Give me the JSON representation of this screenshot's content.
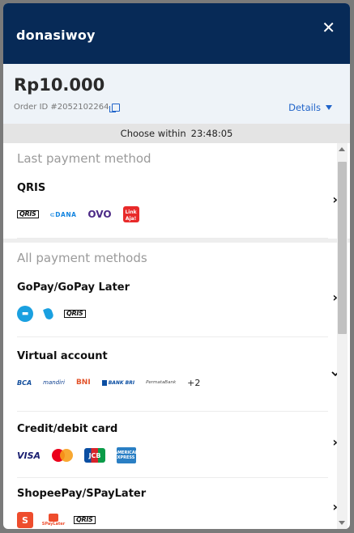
{
  "header": {
    "merchant_name": "donasiwoy",
    "close_icon": "close-icon"
  },
  "summary": {
    "amount": "Rp10.000",
    "order_id": "Order ID #2052102264",
    "details_label": "Details"
  },
  "timer": {
    "label": "Choose within",
    "time": "23:48:05"
  },
  "last_payment": {
    "title": "Last payment method",
    "method": {
      "name": "QRIS",
      "logos": [
        "QRIS",
        "DANA",
        "OVO",
        "LinkAja"
      ]
    }
  },
  "all_payment": {
    "title": "All payment methods",
    "methods": [
      {
        "name": "GoPay/GoPay Later",
        "logos": [
          "gopay-icon",
          "gopaylater-icon",
          "QRIS"
        ]
      },
      {
        "name": "Virtual account",
        "logos": [
          "BCA",
          "mandiri",
          "BNI",
          "BANK BRI",
          "PermataBank"
        ],
        "more": "+2"
      },
      {
        "name": "Credit/debit card",
        "logos": [
          "VISA",
          "mastercard-icon",
          "JCB",
          "AMEX"
        ]
      },
      {
        "name": "ShopeePay/SPayLater",
        "logos": [
          "shopee-icon",
          "SPayLater",
          "QRIS"
        ]
      }
    ]
  },
  "logo_text": {
    "qris": "QRIS",
    "dana": "⊂DANA",
    "ovo": "OVO",
    "linkaja": "Link Aja!",
    "bca": "BCA",
    "mandiri": "mandiri",
    "bni": "BNI",
    "bri": "BANK BRI",
    "permata": "PermataBank",
    "visa": "VISA",
    "jcb": "JCB",
    "amex": "AMERICAN EXPRESS",
    "shopee": "S",
    "spaylater": "SPayLater"
  },
  "colors": {
    "header_bg": "#072a57",
    "accent": "#1f63c9",
    "summary_bg": "#eef3f8"
  }
}
